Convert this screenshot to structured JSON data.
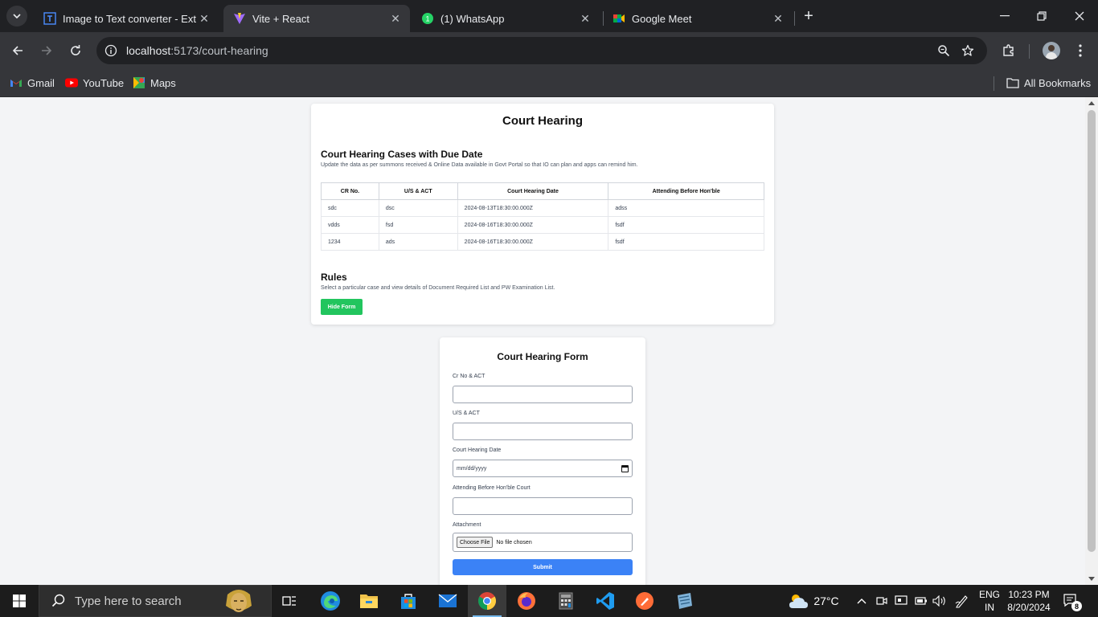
{
  "browser": {
    "tabs": [
      {
        "title": "Image to Text converter - Extrac",
        "active": false
      },
      {
        "title": "Vite + React",
        "active": true
      },
      {
        "title": "(1) WhatsApp",
        "active": false
      },
      {
        "title": "Google Meet",
        "active": false
      }
    ],
    "tab_close_glyph": "✕",
    "new_tab_glyph": "+",
    "url_host": "localhost",
    "url_path": ":5173/court-hearing",
    "bookmarks": [
      {
        "label": "Gmail",
        "icon": "gmail-icon"
      },
      {
        "label": "YouTube",
        "icon": "youtube-icon"
      },
      {
        "label": "Maps",
        "icon": "maps-icon"
      }
    ],
    "all_bookmarks": "All Bookmarks"
  },
  "page": {
    "title": "Court Hearing",
    "cases_heading": "Court Hearing Cases with Due Date",
    "cases_desc": "Update the data as per summons received & Online Data available in Govt Portal so that IO can plan and apps can remind him.",
    "table": {
      "headers": [
        "CR No.",
        "U/S & ACT",
        "Court Hearing Date",
        "Attending Before Hon'ble"
      ],
      "rows": [
        [
          "sdc",
          "dsc",
          "2024-08-13T18:30:00.000Z",
          "adss"
        ],
        [
          "vdds",
          "fsd",
          "2024-08-16T18:30:00.000Z",
          "fsdf"
        ],
        [
          "1234",
          "ads",
          "2024-08-16T18:30:00.000Z",
          "fsdf"
        ]
      ]
    },
    "rules_heading": "Rules",
    "rules_desc": "Select a particular case and view details of Document Required List and PW Examination List.",
    "hide_form_label": "Hide Form"
  },
  "form": {
    "title": "Court Hearing Form",
    "cr_label": "Cr No & ACT",
    "cr_value": "",
    "us_label": "U/S & ACT",
    "us_value": "",
    "date_label": "Court Hearing Date",
    "date_placeholder": "mm/dd/yyyy",
    "attending_label": "Attending Before Hon'ble Court",
    "attending_value": "",
    "attachment_label": "Attachment",
    "choose_file": "Choose File",
    "no_file": "No file chosen",
    "submit_label": "Submit"
  },
  "taskbar": {
    "search_placeholder": "Type here to search",
    "weather": "27°C",
    "lang_line1": "ENG",
    "lang_line2": "IN",
    "time": "10:23 PM",
    "date": "8/20/2024",
    "notification_count": "8"
  },
  "colors": {
    "hide_button": "#22c55e",
    "submit_button": "#3b82f6",
    "chrome_dark": "#202124",
    "chrome_toolbar": "#35363a"
  }
}
